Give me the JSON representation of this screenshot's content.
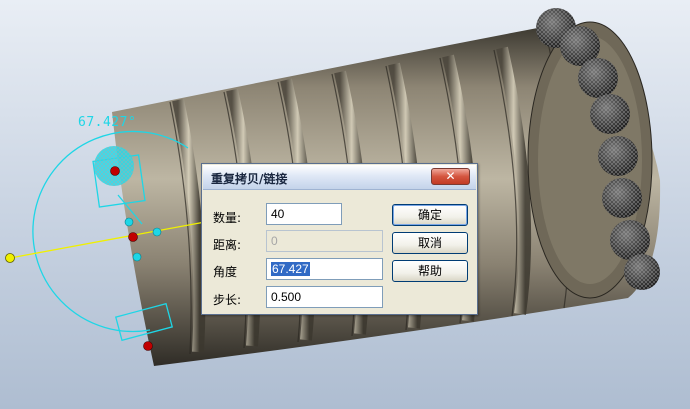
{
  "viewport": {
    "angle_readout": "67.427°"
  },
  "dialog": {
    "title": "重复拷贝/链接",
    "close_symbol": "✕",
    "fields": {
      "count": {
        "label": "数量:",
        "value": "40"
      },
      "distance": {
        "label": "距离:",
        "value": "0"
      },
      "angle": {
        "label": "角度",
        "value": "67.427"
      },
      "step": {
        "label": "步长:",
        "value": "0.500"
      }
    },
    "buttons": {
      "ok": "确定",
      "cancel": "取消",
      "help": "帮助"
    }
  },
  "colors": {
    "cyan_handle": "#1ed6e6",
    "yellow_axis": "#f0f000",
    "red_point": "#c00000",
    "dialog_bg": "#ece9d8"
  }
}
